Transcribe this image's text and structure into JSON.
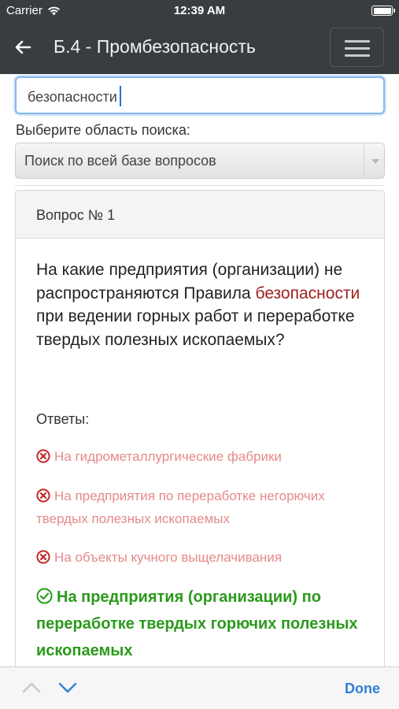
{
  "status_bar": {
    "carrier": "Carrier",
    "time": "12:39 AM"
  },
  "nav": {
    "title": "Б.4 - Промбезопасность"
  },
  "search": {
    "value": "безопасности"
  },
  "scope": {
    "label": "Выберите область поиска:",
    "selected": "Поиск по всей базе вопросов"
  },
  "card": {
    "header": "Вопрос № 1",
    "question_before": "На какие предприятия (организации) не распространяются Правила ",
    "question_highlight": "безопасности",
    "question_after": " при ведении горных работ и переработке твердых полезных ископаемых?",
    "answers_label": "Ответы:",
    "answers": [
      {
        "text": "На гидрометаллургические фабрики",
        "correct": false
      },
      {
        "text": "На предприятия по переработке негорючих твердых полезных ископаемых",
        "correct": false
      },
      {
        "text": "На объекты кучного выщелачивания",
        "correct": false
      },
      {
        "text": "На предприятия (организации) по переработке твердых горючих полезных ископаемых",
        "correct": true
      }
    ]
  },
  "toolbar": {
    "done_label": "Done"
  },
  "colors": {
    "nav_bg": "#3a3d40",
    "highlight": "#a02020",
    "wrong": "#e58a8a",
    "correct": "#2a9a1b",
    "link": "#2f7fd6"
  }
}
